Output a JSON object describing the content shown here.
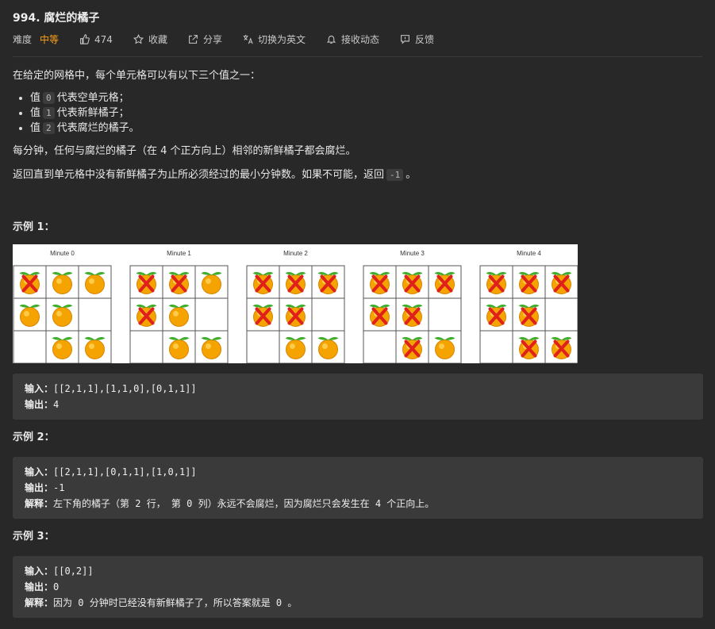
{
  "header": {
    "title": "994. 腐烂的橘子",
    "difficulty_label": "难度",
    "difficulty": "中等",
    "likes": "474",
    "favorite": "收藏",
    "share": "分享",
    "switch_lang": "切换为英文",
    "subscribe": "接收动态",
    "feedback": "反馈"
  },
  "desc": {
    "intro": "在给定的网格中，每个单元格可以有以下三个值之一：",
    "items": [
      {
        "pre": "值",
        "code": "0",
        "post": "代表空单元格；"
      },
      {
        "pre": "值",
        "code": "1",
        "post": "代表新鲜橘子；"
      },
      {
        "pre": "值",
        "code": "2",
        "post": "代表腐烂的橘子。"
      }
    ],
    "p2": "每分钟，任何与腐烂的橘子（在 4 个正方向上）相邻的新鲜橘子都会腐烂。",
    "p3_pre": "返回直到单元格中没有新鲜橘子为止所必须经过的最小分钟数。如果不可能，返回",
    "p3_code": "-1",
    "p3_post": "。"
  },
  "figure": {
    "minutes": [
      "Minute 0",
      "Minute 1",
      "Minute 2",
      "Minute 3",
      "Minute 4"
    ],
    "grids": [
      [
        [
          2,
          1,
          1
        ],
        [
          1,
          1,
          0
        ],
        [
          0,
          1,
          1
        ]
      ],
      [
        [
          2,
          2,
          1
        ],
        [
          2,
          1,
          0
        ],
        [
          0,
          1,
          1
        ]
      ],
      [
        [
          2,
          2,
          2
        ],
        [
          2,
          2,
          0
        ],
        [
          0,
          1,
          1
        ]
      ],
      [
        [
          2,
          2,
          2
        ],
        [
          2,
          2,
          0
        ],
        [
          0,
          2,
          1
        ]
      ],
      [
        [
          2,
          2,
          2
        ],
        [
          2,
          2,
          0
        ],
        [
          0,
          2,
          2
        ]
      ]
    ]
  },
  "examples": [
    {
      "heading": "示例 1：",
      "input_label": "输入：",
      "input": "[[2,1,1],[1,1,0],[0,1,1]]",
      "output_label": "输出：",
      "output": "4"
    },
    {
      "heading": "示例 2：",
      "input_label": "输入：",
      "input": "[[2,1,1],[0,1,1],[1,0,1]]",
      "output_label": "输出：",
      "output": "-1",
      "explain_label": "解释：",
      "explain": "左下角的橘子（第 2 行， 第 0 列）永远不会腐烂，因为腐烂只会发生在 4 个正向上。"
    },
    {
      "heading": "示例 3：",
      "input_label": "输入：",
      "input": "[[0,2]]",
      "output_label": "输出：",
      "output": "0",
      "explain_label": "解释：",
      "explain": "因为 0 分钟时已经没有新鲜橘子了，所以答案就是 0 。"
    }
  ],
  "colors": {
    "accent": "#ffa116",
    "bg": "#282828",
    "code_bg": "#3a3a3a"
  }
}
